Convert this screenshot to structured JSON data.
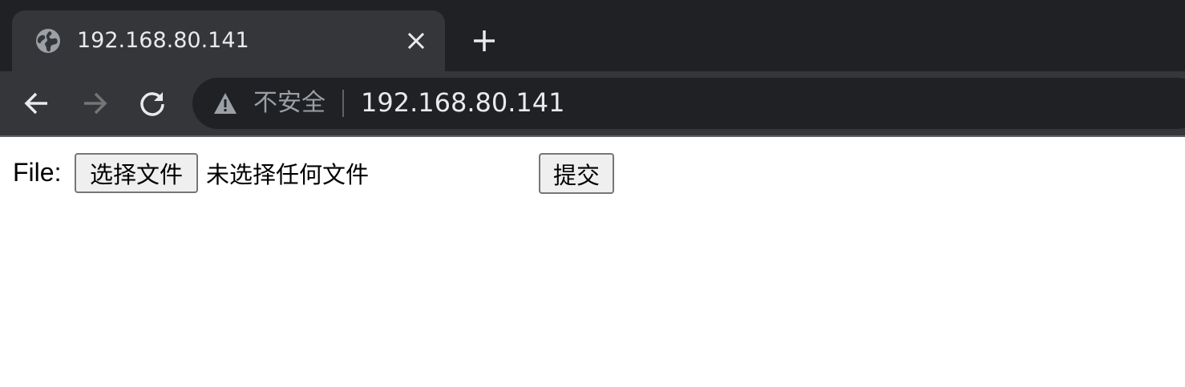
{
  "browser": {
    "tab": {
      "title": "192.168.80.141",
      "favicon": "globe-icon",
      "close_icon": "close-icon"
    },
    "new_tab_icon": "plus-icon",
    "nav": {
      "back_icon": "back-arrow-icon",
      "forward_icon": "forward-arrow-icon",
      "reload_icon": "reload-icon"
    },
    "omnibox": {
      "security_icon": "warning-triangle-icon",
      "security_label": "不安全",
      "url": "192.168.80.141"
    },
    "colors": {
      "frame": "#202124",
      "tab_active": "#35363a",
      "text": "#e8eaed",
      "muted": "#9aa0a6"
    }
  },
  "page": {
    "form": {
      "file_label": "File:",
      "choose_button_label": "选择文件",
      "no_file_text": "未选择任何文件",
      "submit_label": "提交"
    }
  }
}
